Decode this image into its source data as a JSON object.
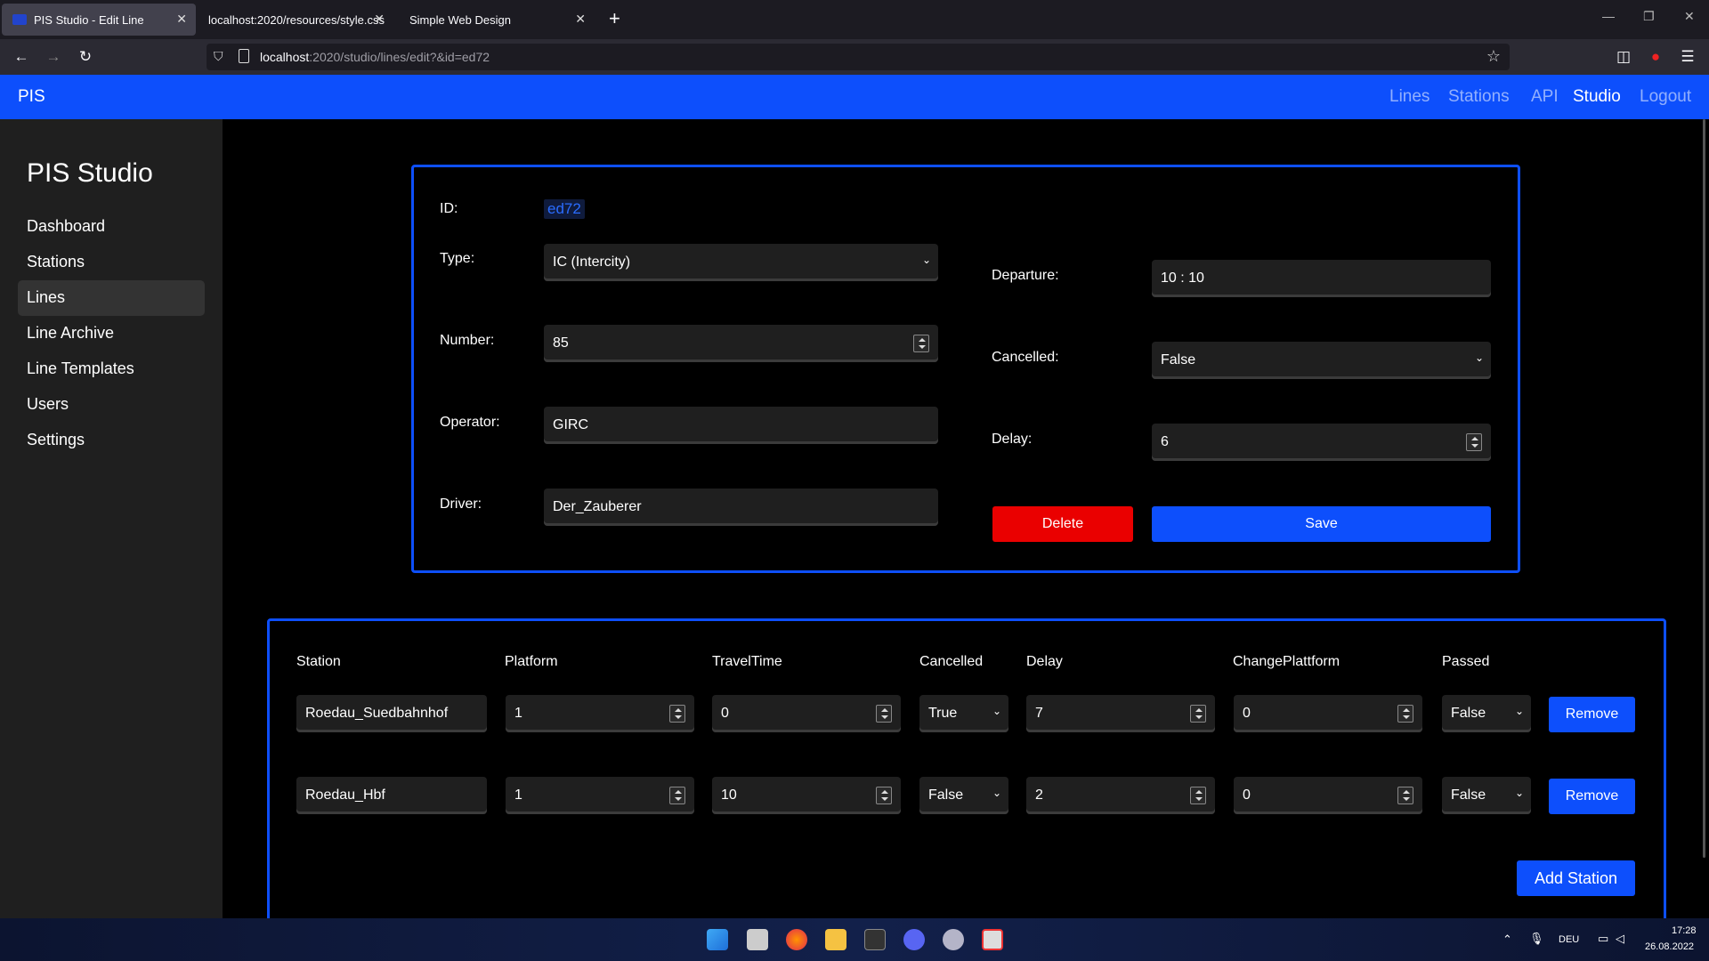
{
  "browser": {
    "tabs": [
      {
        "title": "PIS Studio - Edit Line"
      },
      {
        "title": "localhost:2020/resources/style.css"
      },
      {
        "title": "Simple Web Design"
      }
    ],
    "url_host": "localhost",
    "url_path": ":2020/studio/lines/edit?&id=ed72"
  },
  "header": {
    "brand": "PIS",
    "nav": [
      "Lines",
      "Stations",
      "API",
      "Studio",
      "Logout"
    ],
    "active_nav": "Studio"
  },
  "sidebar": {
    "title": "PIS Studio",
    "items": [
      "Dashboard",
      "Stations",
      "Lines",
      "Line Archive",
      "Line Templates",
      "Users",
      "Settings"
    ],
    "active": "Lines"
  },
  "form": {
    "id_label": "ID:",
    "id_value": "ed72",
    "type_label": "Type:",
    "type_value": "IC (Intercity)",
    "number_label": "Number:",
    "number_value": "85",
    "operator_label": "Operator:",
    "operator_value": "GIRC",
    "driver_label": "Driver:",
    "driver_value": "Der_Zauberer",
    "departure_label": "Departure:",
    "departure_value": "10 : 10",
    "cancelled_label": "Cancelled:",
    "cancelled_value": "False",
    "delay_label": "Delay:",
    "delay_value": "6",
    "delete_label": "Delete",
    "save_label": "Save"
  },
  "stops": {
    "columns": [
      "Station",
      "Platform",
      "TravelTime",
      "Cancelled",
      "Delay",
      "ChangePlattform",
      "Passed"
    ],
    "rows": [
      {
        "station": "Roedau_Suedbahnhof",
        "platform": "1",
        "traveltime": "0",
        "cancelled": "True",
        "delay": "7",
        "changeplatform": "0",
        "passed": "False",
        "remove": "Remove"
      },
      {
        "station": "Roedau_Hbf",
        "platform": "1",
        "traveltime": "10",
        "cancelled": "False",
        "delay": "2",
        "changeplatform": "0",
        "passed": "False",
        "remove": "Remove"
      }
    ],
    "add_label": "Add Station"
  },
  "taskbar": {
    "lang": "DEU",
    "time": "17:28",
    "date": "26.08.2022"
  }
}
